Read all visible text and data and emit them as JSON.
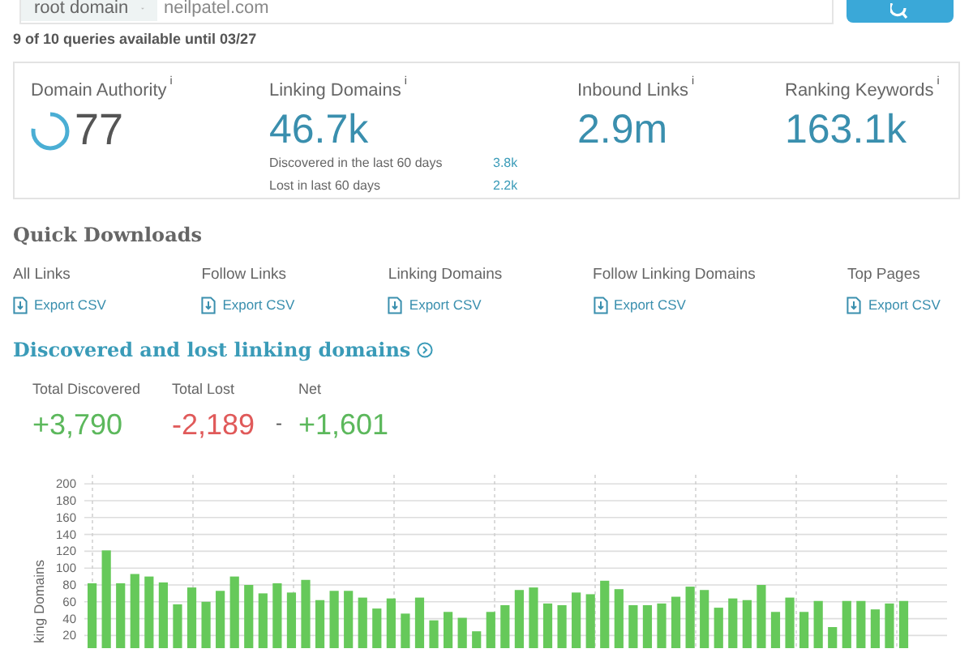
{
  "search": {
    "scope": "root domain",
    "value": "neilpatel.com"
  },
  "quota": "9 of 10 queries available until 03/27",
  "metrics": [
    {
      "kind": "ring",
      "label": "Domain Authority",
      "info": "i",
      "value": "77"
    },
    {
      "kind": "details",
      "label": "Linking Domains",
      "info": "i",
      "value": "46.7k",
      "details": [
        {
          "label": "Discovered in the last 60 days",
          "value": "3.8k"
        },
        {
          "label": "Lost in last 60 days",
          "value": "2.2k"
        }
      ]
    },
    {
      "kind": "plain",
      "label": "Inbound Links",
      "info": "i",
      "value": "2.9m"
    },
    {
      "kind": "plain",
      "label": "Ranking Keywords",
      "info": "i",
      "value": "163.1k"
    }
  ],
  "quick_downloads": {
    "title": "Quick Downloads",
    "items": [
      {
        "label": "All Links",
        "link": "Export CSV"
      },
      {
        "label": "Follow Links",
        "link": "Export CSV"
      },
      {
        "label": "Linking Domains",
        "link": "Export CSV"
      },
      {
        "label": "Follow Linking Domains",
        "link": "Export CSV"
      },
      {
        "label": "Top Pages",
        "link": "Export CSV"
      }
    ]
  },
  "discovered_lost": {
    "title": "Discovered and lost linking domains",
    "totals": [
      {
        "kind": "positive",
        "label": "Total Discovered",
        "value": "+3,790"
      },
      {
        "kind": "negative",
        "label": "Total Lost",
        "value": "-2,189"
      },
      {
        "kind": "positive",
        "label": "Net",
        "value": "+1,601",
        "separator": "-"
      }
    ],
    "chart_data": {
      "type": "bar",
      "grid": true,
      "ylabel": "king Domains",
      "ylim": [
        0,
        205
      ],
      "yticks": [
        20,
        40,
        60,
        80,
        100,
        120,
        140,
        160,
        180,
        200
      ],
      "series": [
        {
          "color": "#66c95a",
          "values": [
            82,
            121,
            82,
            93,
            90,
            83,
            57,
            77,
            60,
            73,
            90,
            80,
            70,
            82,
            71,
            86,
            62,
            73,
            73,
            65,
            52,
            64,
            46,
            65,
            38,
            48,
            41,
            25,
            48,
            56,
            74,
            77,
            58,
            56,
            71,
            69,
            85,
            75,
            56,
            56,
            58,
            66,
            78,
            74,
            53,
            64,
            62,
            80,
            48,
            65,
            48,
            61,
            30,
            61,
            61,
            51,
            58,
            61
          ]
        }
      ]
    }
  }
}
